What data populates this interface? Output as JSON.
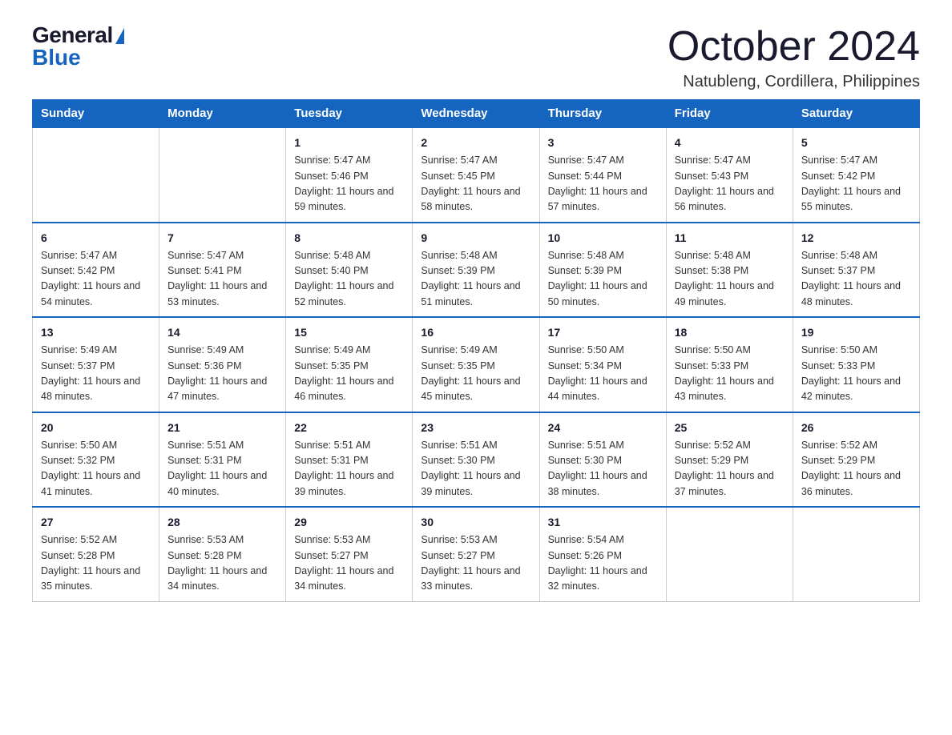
{
  "logo": {
    "general": "General",
    "blue": "Blue"
  },
  "title": "October 2024",
  "location": "Natubleng, Cordillera, Philippines",
  "weekdays": [
    "Sunday",
    "Monday",
    "Tuesday",
    "Wednesday",
    "Thursday",
    "Friday",
    "Saturday"
  ],
  "weeks": [
    [
      {
        "day": "",
        "sunrise": "",
        "sunset": "",
        "daylight": ""
      },
      {
        "day": "",
        "sunrise": "",
        "sunset": "",
        "daylight": ""
      },
      {
        "day": "1",
        "sunrise": "Sunrise: 5:47 AM",
        "sunset": "Sunset: 5:46 PM",
        "daylight": "Daylight: 11 hours and 59 minutes."
      },
      {
        "day": "2",
        "sunrise": "Sunrise: 5:47 AM",
        "sunset": "Sunset: 5:45 PM",
        "daylight": "Daylight: 11 hours and 58 minutes."
      },
      {
        "day": "3",
        "sunrise": "Sunrise: 5:47 AM",
        "sunset": "Sunset: 5:44 PM",
        "daylight": "Daylight: 11 hours and 57 minutes."
      },
      {
        "day": "4",
        "sunrise": "Sunrise: 5:47 AM",
        "sunset": "Sunset: 5:43 PM",
        "daylight": "Daylight: 11 hours and 56 minutes."
      },
      {
        "day": "5",
        "sunrise": "Sunrise: 5:47 AM",
        "sunset": "Sunset: 5:42 PM",
        "daylight": "Daylight: 11 hours and 55 minutes."
      }
    ],
    [
      {
        "day": "6",
        "sunrise": "Sunrise: 5:47 AM",
        "sunset": "Sunset: 5:42 PM",
        "daylight": "Daylight: 11 hours and 54 minutes."
      },
      {
        "day": "7",
        "sunrise": "Sunrise: 5:47 AM",
        "sunset": "Sunset: 5:41 PM",
        "daylight": "Daylight: 11 hours and 53 minutes."
      },
      {
        "day": "8",
        "sunrise": "Sunrise: 5:48 AM",
        "sunset": "Sunset: 5:40 PM",
        "daylight": "Daylight: 11 hours and 52 minutes."
      },
      {
        "day": "9",
        "sunrise": "Sunrise: 5:48 AM",
        "sunset": "Sunset: 5:39 PM",
        "daylight": "Daylight: 11 hours and 51 minutes."
      },
      {
        "day": "10",
        "sunrise": "Sunrise: 5:48 AM",
        "sunset": "Sunset: 5:39 PM",
        "daylight": "Daylight: 11 hours and 50 minutes."
      },
      {
        "day": "11",
        "sunrise": "Sunrise: 5:48 AM",
        "sunset": "Sunset: 5:38 PM",
        "daylight": "Daylight: 11 hours and 49 minutes."
      },
      {
        "day": "12",
        "sunrise": "Sunrise: 5:48 AM",
        "sunset": "Sunset: 5:37 PM",
        "daylight": "Daylight: 11 hours and 48 minutes."
      }
    ],
    [
      {
        "day": "13",
        "sunrise": "Sunrise: 5:49 AM",
        "sunset": "Sunset: 5:37 PM",
        "daylight": "Daylight: 11 hours and 48 minutes."
      },
      {
        "day": "14",
        "sunrise": "Sunrise: 5:49 AM",
        "sunset": "Sunset: 5:36 PM",
        "daylight": "Daylight: 11 hours and 47 minutes."
      },
      {
        "day": "15",
        "sunrise": "Sunrise: 5:49 AM",
        "sunset": "Sunset: 5:35 PM",
        "daylight": "Daylight: 11 hours and 46 minutes."
      },
      {
        "day": "16",
        "sunrise": "Sunrise: 5:49 AM",
        "sunset": "Sunset: 5:35 PM",
        "daylight": "Daylight: 11 hours and 45 minutes."
      },
      {
        "day": "17",
        "sunrise": "Sunrise: 5:50 AM",
        "sunset": "Sunset: 5:34 PM",
        "daylight": "Daylight: 11 hours and 44 minutes."
      },
      {
        "day": "18",
        "sunrise": "Sunrise: 5:50 AM",
        "sunset": "Sunset: 5:33 PM",
        "daylight": "Daylight: 11 hours and 43 minutes."
      },
      {
        "day": "19",
        "sunrise": "Sunrise: 5:50 AM",
        "sunset": "Sunset: 5:33 PM",
        "daylight": "Daylight: 11 hours and 42 minutes."
      }
    ],
    [
      {
        "day": "20",
        "sunrise": "Sunrise: 5:50 AM",
        "sunset": "Sunset: 5:32 PM",
        "daylight": "Daylight: 11 hours and 41 minutes."
      },
      {
        "day": "21",
        "sunrise": "Sunrise: 5:51 AM",
        "sunset": "Sunset: 5:31 PM",
        "daylight": "Daylight: 11 hours and 40 minutes."
      },
      {
        "day": "22",
        "sunrise": "Sunrise: 5:51 AM",
        "sunset": "Sunset: 5:31 PM",
        "daylight": "Daylight: 11 hours and 39 minutes."
      },
      {
        "day": "23",
        "sunrise": "Sunrise: 5:51 AM",
        "sunset": "Sunset: 5:30 PM",
        "daylight": "Daylight: 11 hours and 39 minutes."
      },
      {
        "day": "24",
        "sunrise": "Sunrise: 5:51 AM",
        "sunset": "Sunset: 5:30 PM",
        "daylight": "Daylight: 11 hours and 38 minutes."
      },
      {
        "day": "25",
        "sunrise": "Sunrise: 5:52 AM",
        "sunset": "Sunset: 5:29 PM",
        "daylight": "Daylight: 11 hours and 37 minutes."
      },
      {
        "day": "26",
        "sunrise": "Sunrise: 5:52 AM",
        "sunset": "Sunset: 5:29 PM",
        "daylight": "Daylight: 11 hours and 36 minutes."
      }
    ],
    [
      {
        "day": "27",
        "sunrise": "Sunrise: 5:52 AM",
        "sunset": "Sunset: 5:28 PM",
        "daylight": "Daylight: 11 hours and 35 minutes."
      },
      {
        "day": "28",
        "sunrise": "Sunrise: 5:53 AM",
        "sunset": "Sunset: 5:28 PM",
        "daylight": "Daylight: 11 hours and 34 minutes."
      },
      {
        "day": "29",
        "sunrise": "Sunrise: 5:53 AM",
        "sunset": "Sunset: 5:27 PM",
        "daylight": "Daylight: 11 hours and 34 minutes."
      },
      {
        "day": "30",
        "sunrise": "Sunrise: 5:53 AM",
        "sunset": "Sunset: 5:27 PM",
        "daylight": "Daylight: 11 hours and 33 minutes."
      },
      {
        "day": "31",
        "sunrise": "Sunrise: 5:54 AM",
        "sunset": "Sunset: 5:26 PM",
        "daylight": "Daylight: 11 hours and 32 minutes."
      },
      {
        "day": "",
        "sunrise": "",
        "sunset": "",
        "daylight": ""
      },
      {
        "day": "",
        "sunrise": "",
        "sunset": "",
        "daylight": ""
      }
    ]
  ]
}
